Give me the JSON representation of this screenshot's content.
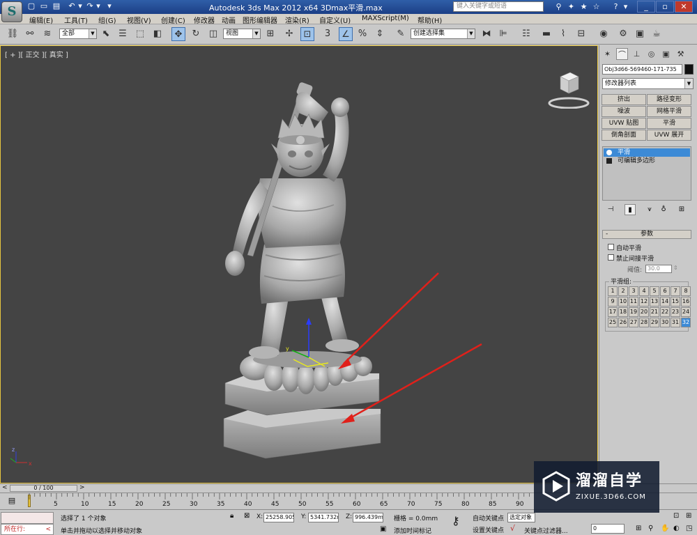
{
  "title": {
    "text": "Autodesk 3ds Max  2012 x64    3Dmax平滑.max",
    "search_placeholder": "键入关键字或短语",
    "logo_letter": "S"
  },
  "menu": [
    "编辑(E)",
    "工具(T)",
    "组(G)",
    "视图(V)",
    "创建(C)",
    "修改器",
    "动画",
    "图形编辑器",
    "渲染(R)",
    "自定义(U)",
    "MAXScript(M)",
    "帮助(H)"
  ],
  "toolbar": {
    "filter_value": "全部",
    "coord_value": "视图",
    "snap_label": "3",
    "percent_label": "%",
    "named_sel_value": "创建选择集"
  },
  "viewport": {
    "label": "[ + ][ 正交 ][ 真实 ]",
    "background_color": "#444444",
    "gizmo_labels": {
      "x": "x",
      "y": "y",
      "z": "z"
    }
  },
  "command_panel": {
    "object_name": "Obj3d66-569460-171-735",
    "modifier_list": "修改器列表",
    "modifier_buttons": [
      "挤出",
      "路径变形",
      "噪波",
      "网格平滑",
      "UVW 贴图",
      "平滑",
      "倒角剖面",
      "UVW 展开"
    ],
    "stack": [
      {
        "label": "平滑",
        "selected": true
      },
      {
        "label": "可编辑多边形",
        "selected": false
      }
    ],
    "rollout_title": "参数",
    "rollout_minus": "-",
    "auto_smooth": "自动平滑",
    "prevent_indirect": "禁止间接平滑",
    "threshold_label": "阈值:",
    "threshold_value": "30.0",
    "smoothing_groups_label": "平滑组:",
    "smoothing_groups": [
      "1",
      "2",
      "3",
      "4",
      "5",
      "6",
      "7",
      "8",
      "9",
      "10",
      "11",
      "12",
      "13",
      "14",
      "15",
      "16",
      "17",
      "18",
      "19",
      "20",
      "21",
      "22",
      "23",
      "24",
      "25",
      "26",
      "27",
      "28",
      "29",
      "30",
      "31",
      "32"
    ],
    "active_group": "32"
  },
  "timeline": {
    "slider_text": "0 / 100",
    "prev": "<",
    "next": ">",
    "ticks": [
      "0",
      "5",
      "10",
      "15",
      "20",
      "25",
      "30",
      "35",
      "40",
      "45",
      "50",
      "55",
      "60",
      "65",
      "70",
      "75",
      "80",
      "85",
      "90"
    ]
  },
  "status": {
    "running_label": "所在行:",
    "selected_text": "选择了 1 个对象",
    "prompt_text": "单击并拖动以选择并移动对象",
    "x_label": "X:",
    "x_value": "25258.905",
    "y_label": "Y:",
    "y_value": "5341.732m",
    "z_label": "Z:",
    "z_value": "996.439mi",
    "grid_text": "栅格 = 0.0mm",
    "add_time_tag": "添加时间标记",
    "auto_key": "自动关键点",
    "set_key": "设置关键点",
    "selected_obj": "选定对象",
    "key_filters": "关键点过滤器...",
    "frame_value": "0"
  },
  "watermark": {
    "title": "溜溜自学",
    "url": "ZIXUE.3D66.COM"
  },
  "colors": {
    "title_bar": "#1c3f86",
    "selection_blue": "#3c8ad6",
    "viewport_border": "#e8c640",
    "arrow_red": "#e0201a"
  }
}
